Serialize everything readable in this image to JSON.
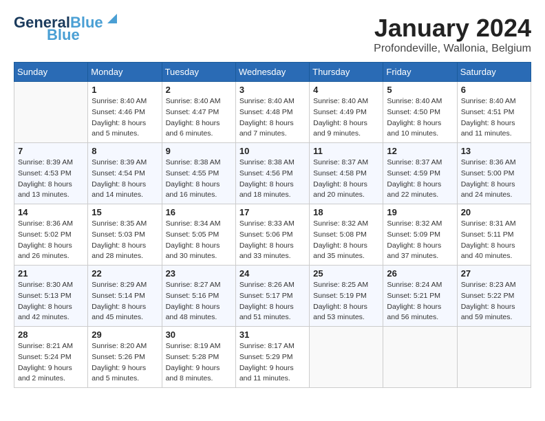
{
  "header": {
    "logo_general": "General",
    "logo_blue": "Blue",
    "month_title": "January 2024",
    "location": "Profondeville, Wallonia, Belgium"
  },
  "weekdays": [
    "Sunday",
    "Monday",
    "Tuesday",
    "Wednesday",
    "Thursday",
    "Friday",
    "Saturday"
  ],
  "weeks": [
    [
      {
        "day": "",
        "sunrise": "",
        "sunset": "",
        "daylight": ""
      },
      {
        "day": "1",
        "sunrise": "Sunrise: 8:40 AM",
        "sunset": "Sunset: 4:46 PM",
        "daylight": "Daylight: 8 hours and 5 minutes."
      },
      {
        "day": "2",
        "sunrise": "Sunrise: 8:40 AM",
        "sunset": "Sunset: 4:47 PM",
        "daylight": "Daylight: 8 hours and 6 minutes."
      },
      {
        "day": "3",
        "sunrise": "Sunrise: 8:40 AM",
        "sunset": "Sunset: 4:48 PM",
        "daylight": "Daylight: 8 hours and 7 minutes."
      },
      {
        "day": "4",
        "sunrise": "Sunrise: 8:40 AM",
        "sunset": "Sunset: 4:49 PM",
        "daylight": "Daylight: 8 hours and 9 minutes."
      },
      {
        "day": "5",
        "sunrise": "Sunrise: 8:40 AM",
        "sunset": "Sunset: 4:50 PM",
        "daylight": "Daylight: 8 hours and 10 minutes."
      },
      {
        "day": "6",
        "sunrise": "Sunrise: 8:40 AM",
        "sunset": "Sunset: 4:51 PM",
        "daylight": "Daylight: 8 hours and 11 minutes."
      }
    ],
    [
      {
        "day": "7",
        "sunrise": "Sunrise: 8:39 AM",
        "sunset": "Sunset: 4:53 PM",
        "daylight": "Daylight: 8 hours and 13 minutes."
      },
      {
        "day": "8",
        "sunrise": "Sunrise: 8:39 AM",
        "sunset": "Sunset: 4:54 PM",
        "daylight": "Daylight: 8 hours and 14 minutes."
      },
      {
        "day": "9",
        "sunrise": "Sunrise: 8:38 AM",
        "sunset": "Sunset: 4:55 PM",
        "daylight": "Daylight: 8 hours and 16 minutes."
      },
      {
        "day": "10",
        "sunrise": "Sunrise: 8:38 AM",
        "sunset": "Sunset: 4:56 PM",
        "daylight": "Daylight: 8 hours and 18 minutes."
      },
      {
        "day": "11",
        "sunrise": "Sunrise: 8:37 AM",
        "sunset": "Sunset: 4:58 PM",
        "daylight": "Daylight: 8 hours and 20 minutes."
      },
      {
        "day": "12",
        "sunrise": "Sunrise: 8:37 AM",
        "sunset": "Sunset: 4:59 PM",
        "daylight": "Daylight: 8 hours and 22 minutes."
      },
      {
        "day": "13",
        "sunrise": "Sunrise: 8:36 AM",
        "sunset": "Sunset: 5:00 PM",
        "daylight": "Daylight: 8 hours and 24 minutes."
      }
    ],
    [
      {
        "day": "14",
        "sunrise": "Sunrise: 8:36 AM",
        "sunset": "Sunset: 5:02 PM",
        "daylight": "Daylight: 8 hours and 26 minutes."
      },
      {
        "day": "15",
        "sunrise": "Sunrise: 8:35 AM",
        "sunset": "Sunset: 5:03 PM",
        "daylight": "Daylight: 8 hours and 28 minutes."
      },
      {
        "day": "16",
        "sunrise": "Sunrise: 8:34 AM",
        "sunset": "Sunset: 5:05 PM",
        "daylight": "Daylight: 8 hours and 30 minutes."
      },
      {
        "day": "17",
        "sunrise": "Sunrise: 8:33 AM",
        "sunset": "Sunset: 5:06 PM",
        "daylight": "Daylight: 8 hours and 33 minutes."
      },
      {
        "day": "18",
        "sunrise": "Sunrise: 8:32 AM",
        "sunset": "Sunset: 5:08 PM",
        "daylight": "Daylight: 8 hours and 35 minutes."
      },
      {
        "day": "19",
        "sunrise": "Sunrise: 8:32 AM",
        "sunset": "Sunset: 5:09 PM",
        "daylight": "Daylight: 8 hours and 37 minutes."
      },
      {
        "day": "20",
        "sunrise": "Sunrise: 8:31 AM",
        "sunset": "Sunset: 5:11 PM",
        "daylight": "Daylight: 8 hours and 40 minutes."
      }
    ],
    [
      {
        "day": "21",
        "sunrise": "Sunrise: 8:30 AM",
        "sunset": "Sunset: 5:13 PM",
        "daylight": "Daylight: 8 hours and 42 minutes."
      },
      {
        "day": "22",
        "sunrise": "Sunrise: 8:29 AM",
        "sunset": "Sunset: 5:14 PM",
        "daylight": "Daylight: 8 hours and 45 minutes."
      },
      {
        "day": "23",
        "sunrise": "Sunrise: 8:27 AM",
        "sunset": "Sunset: 5:16 PM",
        "daylight": "Daylight: 8 hours and 48 minutes."
      },
      {
        "day": "24",
        "sunrise": "Sunrise: 8:26 AM",
        "sunset": "Sunset: 5:17 PM",
        "daylight": "Daylight: 8 hours and 51 minutes."
      },
      {
        "day": "25",
        "sunrise": "Sunrise: 8:25 AM",
        "sunset": "Sunset: 5:19 PM",
        "daylight": "Daylight: 8 hours and 53 minutes."
      },
      {
        "day": "26",
        "sunrise": "Sunrise: 8:24 AM",
        "sunset": "Sunset: 5:21 PM",
        "daylight": "Daylight: 8 hours and 56 minutes."
      },
      {
        "day": "27",
        "sunrise": "Sunrise: 8:23 AM",
        "sunset": "Sunset: 5:22 PM",
        "daylight": "Daylight: 8 hours and 59 minutes."
      }
    ],
    [
      {
        "day": "28",
        "sunrise": "Sunrise: 8:21 AM",
        "sunset": "Sunset: 5:24 PM",
        "daylight": "Daylight: 9 hours and 2 minutes."
      },
      {
        "day": "29",
        "sunrise": "Sunrise: 8:20 AM",
        "sunset": "Sunset: 5:26 PM",
        "daylight": "Daylight: 9 hours and 5 minutes."
      },
      {
        "day": "30",
        "sunrise": "Sunrise: 8:19 AM",
        "sunset": "Sunset: 5:28 PM",
        "daylight": "Daylight: 9 hours and 8 minutes."
      },
      {
        "day": "31",
        "sunrise": "Sunrise: 8:17 AM",
        "sunset": "Sunset: 5:29 PM",
        "daylight": "Daylight: 9 hours and 11 minutes."
      },
      {
        "day": "",
        "sunrise": "",
        "sunset": "",
        "daylight": ""
      },
      {
        "day": "",
        "sunrise": "",
        "sunset": "",
        "daylight": ""
      },
      {
        "day": "",
        "sunrise": "",
        "sunset": "",
        "daylight": ""
      }
    ]
  ]
}
